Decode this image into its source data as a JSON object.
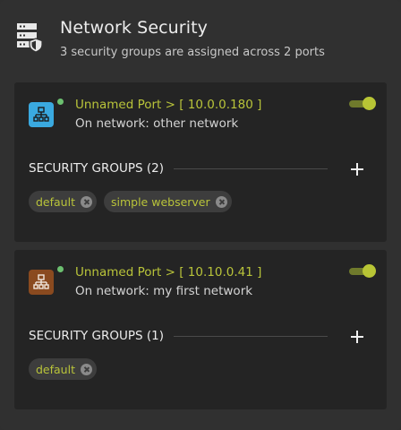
{
  "header": {
    "icon": "server-shield-icon",
    "title": "Network Security",
    "subtitle": "3 security groups are assigned across 2 ports"
  },
  "ports": [
    {
      "name": "Unnamed Port > [ 10.0.0.180 ]",
      "network": "On network: other network",
      "icon": "network-icon",
      "icon_color": "#3aa9e0",
      "status_color": "#6cc070",
      "enabled": true,
      "sg_label": "SECURITY GROUPS (2)",
      "groups": [
        {
          "label": "default"
        },
        {
          "label": "simple webserver"
        }
      ]
    },
    {
      "name": "Unnamed Port > [ 10.10.0.41 ]",
      "network": "On network: my first network",
      "icon": "network-icon",
      "icon_color": "#8a4a1f",
      "status_color": "#6cc070",
      "enabled": true,
      "sg_label": "SECURITY GROUPS (1)",
      "groups": [
        {
          "label": "default"
        }
      ]
    }
  ],
  "colors": {
    "accent": "#b9c43a",
    "card": "#242424",
    "background": "#303030"
  }
}
